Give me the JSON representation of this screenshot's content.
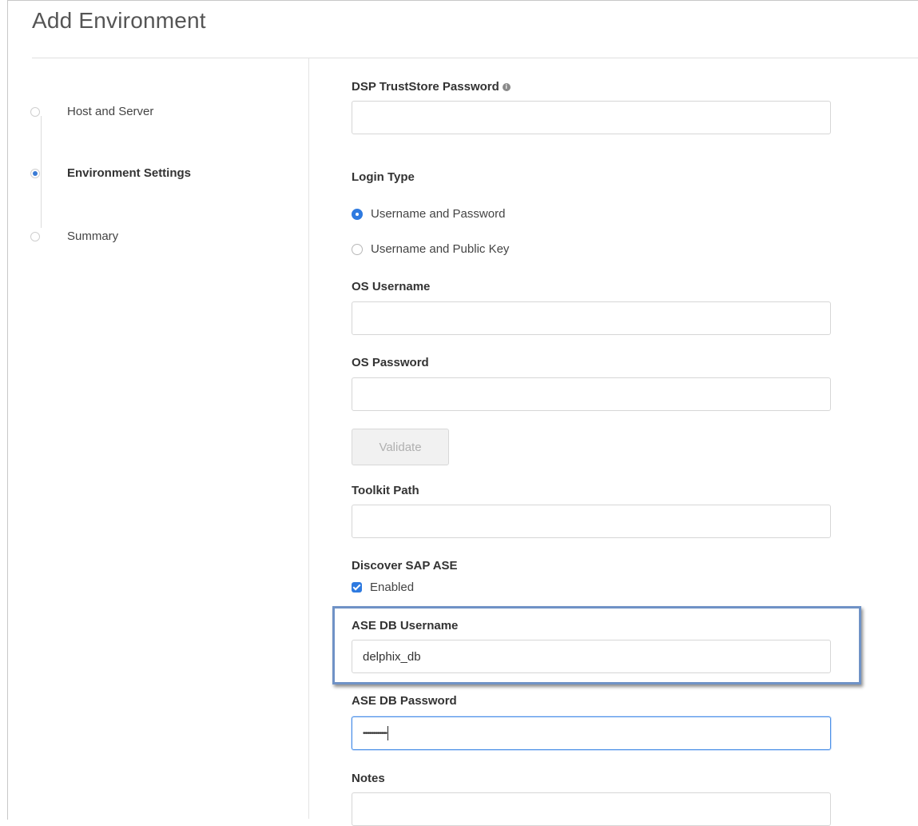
{
  "header": {
    "title": "Add Environment"
  },
  "steps": [
    {
      "label": "Host and Server",
      "active": false
    },
    {
      "label": "Environment Settings",
      "active": true
    },
    {
      "label": "Summary",
      "active": false
    }
  ],
  "form": {
    "dsp_truststore_password": {
      "label": "DSP TrustStore Password",
      "value": "",
      "info_icon": "info-icon"
    },
    "login_type": {
      "label": "Login Type",
      "options": [
        "Username and Password",
        "Username and Public Key"
      ],
      "selected": "Username and Password"
    },
    "os_username": {
      "label": "OS Username",
      "value": ""
    },
    "os_password": {
      "label": "OS Password",
      "value": ""
    },
    "validate_label": "Validate",
    "toolkit_path": {
      "label": "Toolkit Path",
      "value": ""
    },
    "discover_sap_ase": {
      "label": "Discover SAP ASE",
      "checkbox_label": "Enabled",
      "checked": true
    },
    "ase_db_username": {
      "label": "ASE DB Username",
      "value": "delphix_db"
    },
    "ase_db_password": {
      "label": "ASE DB Password",
      "value": "••••••••••••"
    },
    "notes": {
      "label": "Notes",
      "value": ""
    }
  },
  "colors": {
    "accent": "#2e7ae0",
    "highlight_border": "#6f92c6"
  }
}
